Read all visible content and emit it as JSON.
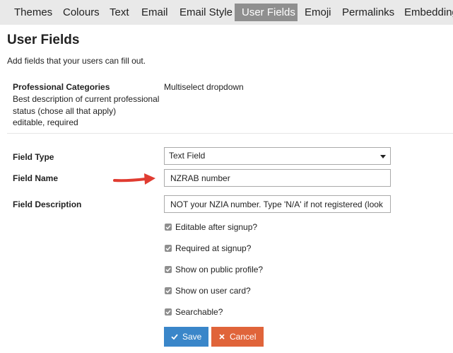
{
  "tabs": [
    {
      "label": "Themes",
      "active": false
    },
    {
      "label": "Colours",
      "active": false
    },
    {
      "label": "Text",
      "active": false
    },
    {
      "label": "Email",
      "active": false
    },
    {
      "label": "Email Style",
      "active": false
    },
    {
      "label": "User Fields",
      "active": true
    },
    {
      "label": "Emoji",
      "active": false
    },
    {
      "label": "Permalinks",
      "active": false
    },
    {
      "label": "Embedding",
      "active": false
    }
  ],
  "page": {
    "title": "User Fields",
    "subtitle": "Add fields that your users can fill out."
  },
  "existing_field": {
    "name": "Professional Categories",
    "description": "Best description of current professional status (chose all that apply)",
    "flags": "editable, required",
    "type": "Multiselect dropdown"
  },
  "form": {
    "field_type_label": "Field Type",
    "field_type_value": "Text Field",
    "field_name_label": "Field Name",
    "field_name_value": "NZRAB number",
    "field_description_label": "Field Description",
    "field_description_value": "NOT your NZIA number. Type 'N/A' if not registered (look",
    "checkboxes": [
      {
        "label": "Editable after signup?",
        "checked": true
      },
      {
        "label": "Required at signup?",
        "checked": true
      },
      {
        "label": "Show on public profile?",
        "checked": true
      },
      {
        "label": "Show on user card?",
        "checked": true
      },
      {
        "label": "Searchable?",
        "checked": true
      }
    ],
    "save_label": "Save",
    "cancel_label": "Cancel"
  },
  "colors": {
    "tab_bar": "#e9e9e9",
    "tab_active": "#8f8f8f",
    "save_button": "#3a86c9",
    "cancel_button": "#e0643a",
    "annotation_arrow": "#e03c31"
  },
  "icons": {
    "save": "check-icon",
    "cancel": "times-icon",
    "dropdown": "caret-down-icon",
    "annotation": "red-arrow-icon"
  }
}
